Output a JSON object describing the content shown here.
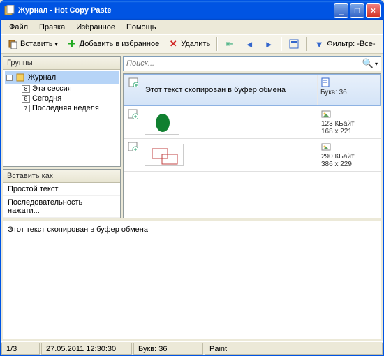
{
  "title": "Журнал - Hot Copy Paste",
  "menu": {
    "file": "Файл",
    "edit": "Правка",
    "fav": "Избранное",
    "help": "Помощь"
  },
  "toolbar": {
    "paste": "Вставить",
    "addfav": "Добавить в избранное",
    "del": "Удалить",
    "filter_label": "Фильтр:",
    "filter_value": "-Все-"
  },
  "groups": {
    "header": "Группы",
    "root": "Журнал",
    "children": [
      {
        "badge": "8",
        "label": "Эта сессия"
      },
      {
        "badge": "8",
        "label": "Сегодня"
      },
      {
        "badge": "7",
        "label": "Последняя неделя"
      }
    ]
  },
  "paste_as": {
    "header": "Вставить как",
    "items": [
      "Простой текст",
      "Последовательность нажати..."
    ]
  },
  "search_placeholder": "Поиск...",
  "clips": [
    {
      "text": "Этот текст скопирован в буфер обмена",
      "meta1": "Букв: 36",
      "selected": true,
      "type": "text"
    },
    {
      "text": "",
      "meta1": "123 КБайт",
      "meta2": "168 x 221",
      "type": "image_oval"
    },
    {
      "text": "",
      "meta1": "290 КБайт",
      "meta2": "386 x 229",
      "type": "image_rects"
    }
  ],
  "preview_text": "Этот текст скопирован в буфер обмена",
  "status": {
    "pos": "1/3",
    "date": "27.05.2011 12:30:30",
    "chars": "Букв: 36",
    "app": "Paint"
  }
}
